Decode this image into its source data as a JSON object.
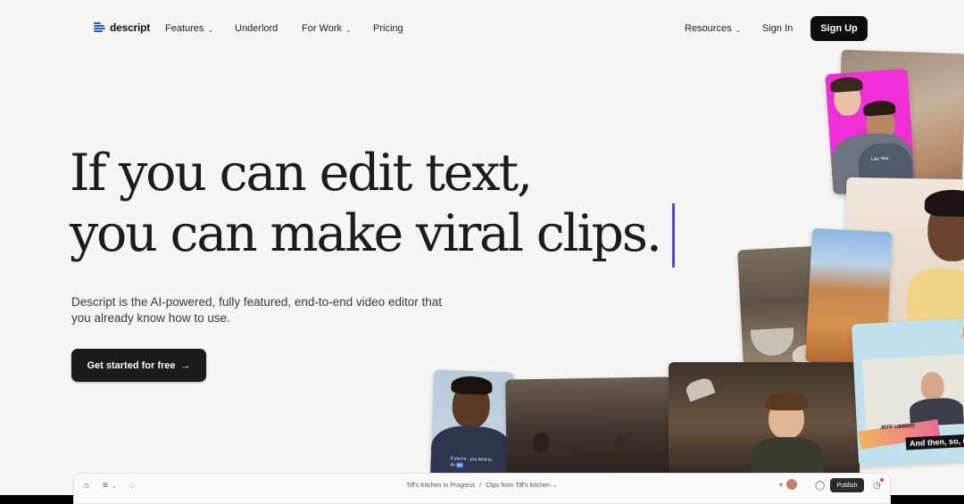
{
  "brand": {
    "name": "descript",
    "accent_color": "#1f5fe0"
  },
  "nav": {
    "features": "Features",
    "underlord": "Underlord",
    "for_work": "For Work",
    "pricing": "Pricing",
    "resources": "Resources",
    "sign_in": "Sign In",
    "sign_up": "Sign Up"
  },
  "hero": {
    "headline_line1": "If you can edit text,",
    "headline_line2": "you can make viral clips.",
    "caret_color": "#4b4bd6",
    "subtext": "Descript is the AI-powered, fully featured, end-to-end video editor that you already know how to use.",
    "cta_label": "Get started for free",
    "cta_arrow": "→"
  },
  "media": {
    "shirt_text": "Like Wat",
    "caption_card": "If you're , you tend to do",
    "caption_card_highlight": "aut",
    "name_tag": "JEFF UMBRO",
    "subtitle": "And then, so, i",
    "letter": "R"
  },
  "editor": {
    "breadcrumb_project": "Tiff's Kitchen In Progress",
    "breadcrumb_separator": "/",
    "breadcrumb_clip": "Clips from Tiff's Kitchen",
    "publish_label": "Publish",
    "icons": [
      "home-icon",
      "menu-icon",
      "chevron-down-icon",
      "status-icon",
      "add-collaborator-icon",
      "comment-icon",
      "share-icon",
      "timer-icon"
    ]
  }
}
